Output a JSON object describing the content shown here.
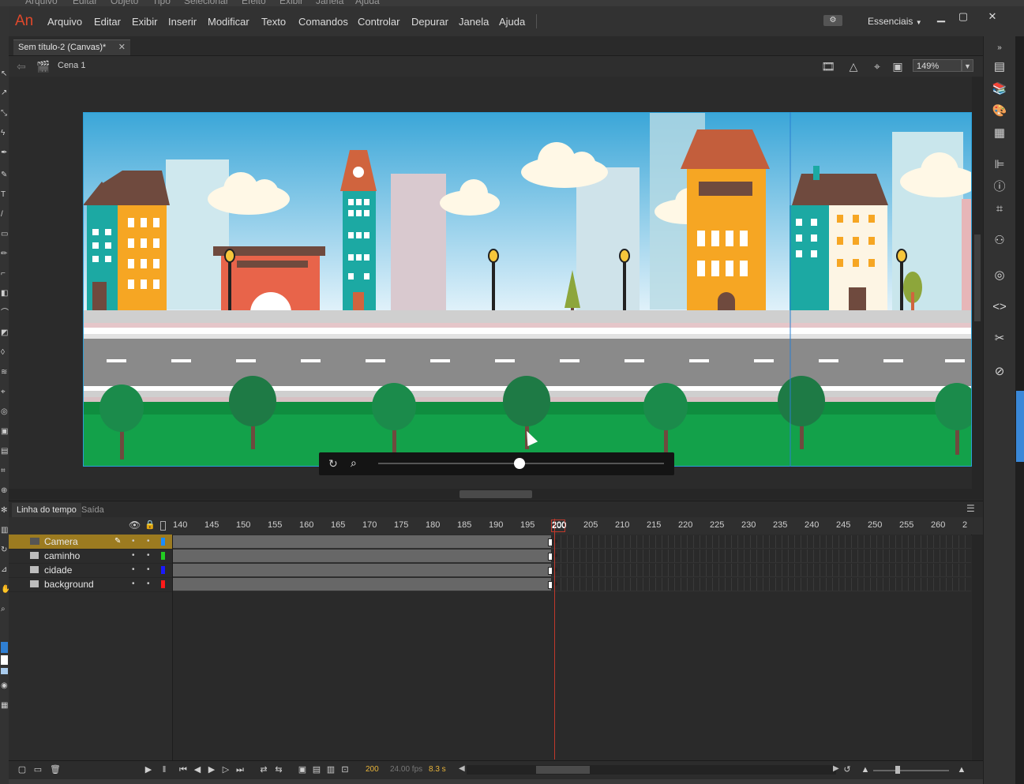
{
  "app": {
    "logo": "An",
    "ghost_menu": [
      "Arquivo",
      "Editar",
      "Objeto",
      "Tipo",
      "Selecionar",
      "Efeito",
      "Exibir",
      "Janela",
      "Ajuda"
    ],
    "menu": [
      "Arquivo",
      "Editar",
      "Exibir",
      "Inserir",
      "Modificar",
      "Texto",
      "Comandos",
      "Controlar",
      "Depurar",
      "Janela",
      "Ajuda"
    ],
    "workspace": "Essenciais",
    "window_controls": [
      "▁",
      "▢",
      "✕"
    ]
  },
  "document": {
    "tab_title": "Sem título-2 (Canvas)*",
    "tab_close": "✕",
    "scene": "Cena 1",
    "zoom": "149%"
  },
  "timeline": {
    "tab_active": "Linha do tempo",
    "tab_output": "Saída",
    "ruler": [
      "140",
      "145",
      "150",
      "155",
      "160",
      "165",
      "170",
      "175",
      "180",
      "185",
      "190",
      "195",
      "200",
      "205",
      "210",
      "215",
      "220",
      "225",
      "230",
      "235",
      "240",
      "245",
      "250",
      "255",
      "260",
      "2"
    ],
    "current_frame": "200",
    "layers": [
      {
        "name": "Camera",
        "color": "#1a8cff",
        "selected": true
      },
      {
        "name": "caminho",
        "color": "#22cc22",
        "selected": false
      },
      {
        "name": "cidade",
        "color": "#1a1aff",
        "selected": false
      },
      {
        "name": "background",
        "color": "#ff1a1a",
        "selected": false
      }
    ],
    "footer": {
      "frame": "200",
      "fps": "24.00 fps",
      "time": "8.3 s"
    }
  },
  "camera_control": {
    "zoom_level_fraction": 0.5
  },
  "colors": {
    "accent_selected_layer": "#9c7b20",
    "playhead": "#c0392b",
    "sky": "#bfe3f5"
  }
}
